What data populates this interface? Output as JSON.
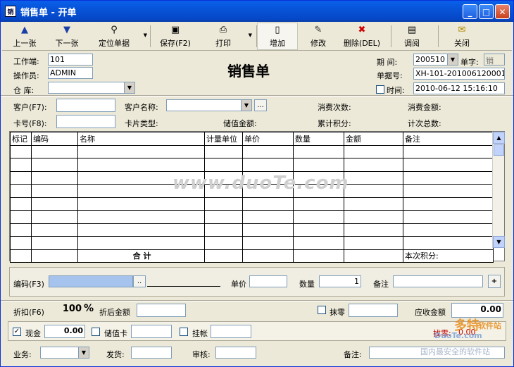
{
  "window": {
    "title": "销售单 - 开单",
    "app_icon": "销"
  },
  "toolbar": [
    {
      "name": "prev",
      "icon": "up-arrow-icon",
      "glyph": "▲",
      "label": "上一张"
    },
    {
      "name": "next",
      "icon": "down-arrow-icon",
      "glyph": "▼",
      "label": "下一张"
    },
    {
      "name": "locate",
      "icon": "binoculars-icon",
      "glyph": "⚲",
      "label": "定位单据",
      "dropdown": true
    },
    {
      "name": "save",
      "icon": "floppy-icon",
      "glyph": "▣",
      "label": "保存(F2)"
    },
    {
      "name": "print",
      "icon": "printer-icon",
      "glyph": "⎙",
      "label": "打印",
      "dropdown": true
    },
    {
      "name": "add",
      "icon": "new-doc-icon",
      "glyph": "▯",
      "label": "增加"
    },
    {
      "name": "edit",
      "icon": "edit-doc-icon",
      "glyph": "✎",
      "label": "修改"
    },
    {
      "name": "delete",
      "icon": "delete-doc-icon",
      "glyph": "✖",
      "label": "删除(DEL)"
    },
    {
      "name": "browse",
      "icon": "browse-icon",
      "glyph": "▤",
      "label": "调阅"
    },
    {
      "name": "close",
      "icon": "close-folder-icon",
      "glyph": "✉",
      "label": "关闭"
    }
  ],
  "header": {
    "terminal_label": "工作端:",
    "terminal_value": "101",
    "operator_label": "操作员:",
    "operator_value": "ADMIN",
    "warehouse_label": "仓  库:",
    "warehouse_value": "",
    "doc_title": "销售单",
    "period_label": "期 间:",
    "period_value": "200510",
    "unit_label": "单字:",
    "unit_value": "销",
    "docno_label": "单据号:",
    "docno_value": "XH-101-201006120001",
    "time_label": "时间:",
    "time_value": "2010-06-12 15:16:10"
  },
  "customer": {
    "cust_label": "客户(F7):",
    "cust_value": "",
    "cust_name_label": "客户名称:",
    "cust_name_value": "",
    "browse": "...",
    "card_label": "卡号(F8):",
    "card_value": "",
    "card_type_label": "卡片类型:",
    "stored_label": "储值金额:",
    "visits_label": "消费次数:",
    "points_label": "累计积分:",
    "spend_label": "消费金额:",
    "count_label": "计次总数:"
  },
  "grid": {
    "columns": [
      "标记",
      "编码",
      "名称",
      "计量单位",
      "单价",
      "数量",
      "金额",
      "备注"
    ],
    "total_label": "合      计",
    "points_label": "本次积分:"
  },
  "entry": {
    "code_label": "编码(F3)",
    "code_value": "",
    "browse": "..",
    "price_label": "单价",
    "price_value": "",
    "qty_label": "数量",
    "qty_value": "1",
    "remark_label": "备注",
    "remark_value": "",
    "add_btn": "+"
  },
  "discount": {
    "label": "折扣(F6)",
    "value": "100",
    "pct": "%",
    "after_label": "折后金额",
    "after_value": "",
    "round_label": "抹零",
    "round_value": "",
    "receivable_label": "应收金额",
    "receivable_value": "0.00"
  },
  "payment": {
    "cash_label": "现金",
    "cash_checked": true,
    "cash_value": "0.00",
    "stored_label": "储值卡",
    "stored_value": "",
    "credit_label": "挂帐",
    "credit_value": "",
    "change_label": "找零:",
    "change_value": "0.00"
  },
  "footer": {
    "business_label": "业务:",
    "business_value": "",
    "ship_label": "发货:",
    "ship_value": "",
    "audit_label": "审核:",
    "audit_value": "",
    "remark_label": "备注:",
    "remark_value": ""
  },
  "watermark": "www.duoTe.com",
  "brand": {
    "name": "多特",
    "sub": "软件站",
    "url": "DuoTe.com",
    "slogan": "国内最安全的软件站"
  },
  "colors": {
    "title_bar": "#0a5fea",
    "change_text": "#c00000"
  }
}
